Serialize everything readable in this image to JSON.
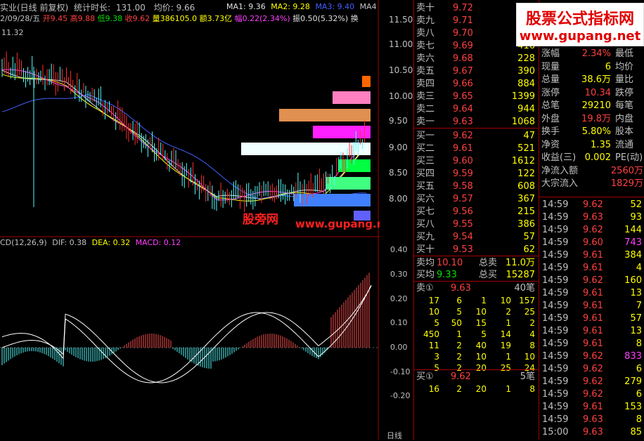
{
  "header": {
    "title": "实业(日线 前复权)",
    "stat_time_label": "统计时长:",
    "stat_time": "131.00",
    "avg_label": "均价:",
    "avg": "9.66",
    "ma1_label": "MA1: 9.36",
    "ma2_label": "MA2: 9.28",
    "ma3_label": "MA3: 9.40",
    "ma4_label": "MA4",
    "date": "2/09/28/五",
    "open": "开9.45",
    "high": "高9.88",
    "low": "低9.38",
    "close": "收9.62",
    "volume": "量386105.0",
    "amount": "额3.73亿",
    "change": "幅0.22(2.34%)",
    "amplitude": "振0.50(5.32%)",
    "turnover": "换",
    "top_price": "11.32"
  },
  "price_axis": [
    "11.50",
    "11.00",
    "10.50",
    "10.00",
    "9.50",
    "9.00",
    "8.50",
    "8.00"
  ],
  "macd_header": {
    "label": "CD(12,26,9)",
    "dif": "DIF: 0.38",
    "dea": "DEA: 0.32",
    "macd": "MACD: 0.12"
  },
  "macd_axis": [
    "0.40",
    "0.30",
    "0.20",
    "0.10",
    "0.00",
    "-0.10",
    "-0.20"
  ],
  "watermark": {
    "cn": "股票公式指标网",
    "url": "www.gupang.net",
    "overlay1": "股旁网",
    "overlay2": "www.gupang.net"
  },
  "sell_book": [
    {
      "label": "卖十",
      "price": "9.72",
      "vol": ""
    },
    {
      "label": "卖九",
      "price": "9.71",
      "vol": ""
    },
    {
      "label": "卖八",
      "price": "9.70",
      "vol": ""
    },
    {
      "label": "卖七",
      "price": "9.69",
      "vol": "416"
    },
    {
      "label": "卖六",
      "price": "9.68",
      "vol": "228"
    },
    {
      "label": "卖五",
      "price": "9.67",
      "vol": "390"
    },
    {
      "label": "卖四",
      "price": "9.66",
      "vol": "884"
    },
    {
      "label": "卖三",
      "price": "9.65",
      "vol": "1399"
    },
    {
      "label": "卖二",
      "price": "9.64",
      "vol": "944"
    },
    {
      "label": "卖一",
      "price": "9.63",
      "vol": "1068"
    }
  ],
  "buy_book": [
    {
      "label": "买一",
      "price": "9.62",
      "vol": "47"
    },
    {
      "label": "买二",
      "price": "9.61",
      "vol": "521"
    },
    {
      "label": "买三",
      "price": "9.60",
      "vol": "1612"
    },
    {
      "label": "买四",
      "price": "9.59",
      "vol": "122"
    },
    {
      "label": "买五",
      "price": "9.58",
      "vol": "608"
    },
    {
      "label": "买六",
      "price": "9.57",
      "vol": "367"
    },
    {
      "label": "买七",
      "price": "9.56",
      "vol": "215"
    },
    {
      "label": "买八",
      "price": "9.55",
      "vol": "386"
    },
    {
      "label": "买九",
      "price": "9.54",
      "vol": "57"
    },
    {
      "label": "买十",
      "price": "9.53",
      "vol": "62"
    }
  ],
  "summary": [
    {
      "l1": "卖均",
      "v1": "10.10",
      "l2": "总卖",
      "v2": "11.0万"
    },
    {
      "l1": "买均",
      "v1": "9.33",
      "l2": "总买",
      "v2": "15287"
    }
  ],
  "sell1_detail": {
    "label": "卖①",
    "price": "9.63",
    "count": "40笔",
    "rows": [
      [
        "17",
        "6",
        "1",
        "10",
        "157"
      ],
      [
        "10",
        "5",
        "10",
        "2",
        "25"
      ],
      [
        "5",
        "50",
        "15",
        "1",
        "2"
      ],
      [
        "450",
        "1",
        "5",
        "14",
        "4"
      ],
      [
        "11",
        "2",
        "40",
        "19",
        "8"
      ],
      [
        "3",
        "2",
        "10",
        "1",
        "10"
      ],
      [
        "5",
        "2",
        "20",
        "25",
        "24"
      ]
    ]
  },
  "buy1_detail": {
    "label": "买①",
    "price": "9.62",
    "count": "5笔",
    "rows": [
      [
        "16",
        "2",
        "20",
        "1",
        "8"
      ]
    ]
  },
  "stats": [
    {
      "l": "涨幅",
      "v": "2.34%",
      "l2": "最低"
    },
    {
      "l": "现量",
      "v": "6",
      "l2": "均价"
    },
    {
      "l": "总量",
      "v": "38.6万",
      "l2": "量比"
    },
    {
      "l": "涨停",
      "v": "10.34",
      "l2": "跌停"
    },
    {
      "l": "总笔",
      "v": "29210",
      "l2": "每笔"
    },
    {
      "l": "外盘",
      "v": "19.8万",
      "l2": "内盘"
    },
    {
      "l": "换手",
      "v": "5.80%",
      "l2": "股本"
    },
    {
      "l": "净资",
      "v": "1.35",
      "l2": "流通"
    },
    {
      "l": "收益(三)",
      "v": "0.002",
      "l2": "PE(动)"
    },
    {
      "l": "净流入额",
      "v": "2560万"
    },
    {
      "l": "大宗流入",
      "v": "1829万"
    }
  ],
  "ticks": [
    {
      "t": "14:59",
      "p": "9.62",
      "v": "52"
    },
    {
      "t": "14:59",
      "p": "9.63",
      "v": "93"
    },
    {
      "t": "14:59",
      "p": "9.62",
      "v": "144"
    },
    {
      "t": "14:59",
      "p": "9.60",
      "v": "743"
    },
    {
      "t": "14:59",
      "p": "9.61",
      "v": "384"
    },
    {
      "t": "14:59",
      "p": "9.61",
      "v": "4"
    },
    {
      "t": "14:59",
      "p": "9.62",
      "v": "160"
    },
    {
      "t": "14:59",
      "p": "9.61",
      "v": "13"
    },
    {
      "t": "14:59",
      "p": "9.61",
      "v": "7"
    },
    {
      "t": "14:59",
      "p": "9.61",
      "v": "57"
    },
    {
      "t": "14:59",
      "p": "9.61",
      "v": "13"
    },
    {
      "t": "14:59",
      "p": "9.61",
      "v": "8"
    },
    {
      "t": "14:59",
      "p": "9.62",
      "v": "833"
    },
    {
      "t": "14:59",
      "p": "9.62",
      "v": "6"
    },
    {
      "t": "14:59",
      "p": "9.62",
      "v": "279"
    },
    {
      "t": "14:59",
      "p": "9.62",
      "v": "6"
    },
    {
      "t": "14:59",
      "p": "9.61",
      "v": "153"
    },
    {
      "t": "14:59",
      "p": "9.63",
      "v": "8"
    },
    {
      "t": "15:00",
      "p": "9.63",
      "v": "85"
    }
  ],
  "bottom_tab": "日线"
}
